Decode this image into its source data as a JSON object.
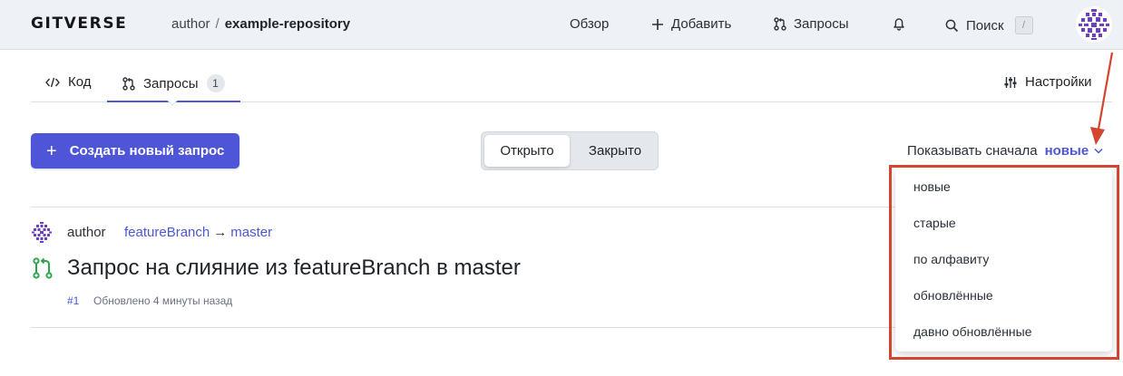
{
  "header": {
    "logo": "GITVERSE",
    "breadcrumb": {
      "separator": "/",
      "owner": "author",
      "repo": "example-repository"
    },
    "nav": {
      "overview": "Обзор",
      "add": "Добавить",
      "requests": "Запросы",
      "search": "Поиск",
      "search_shortcut": "/"
    }
  },
  "tabs": {
    "code": "Код",
    "requests": "Запросы",
    "requests_count": "1",
    "settings": "Настройки"
  },
  "toolbar": {
    "create_button": "Создать новый запрос",
    "filter": {
      "open": "Открыто",
      "closed": "Закрыто",
      "selected": "Открыто"
    },
    "sort_label": "Показывать сначала",
    "sort_value": "новые"
  },
  "pull_requests": [
    {
      "author": "author",
      "source_branch": "featureBranch",
      "arrow": "→",
      "target_branch": "master",
      "title": "Запрос на слияние из featureBranch в master",
      "number": "#1",
      "updated": "Обновлено 4 минуты назад"
    }
  ],
  "sort_menu": {
    "options": [
      "новые",
      "старые",
      "по алфавиту",
      "обновлённые",
      "давно обновлённые"
    ]
  },
  "colors": {
    "accent": "#4e55d6",
    "header_bg": "#eef1f5",
    "annotation": "#d4442f",
    "merge_icon": "#2da44e",
    "avatar": "#6e3fc2"
  }
}
